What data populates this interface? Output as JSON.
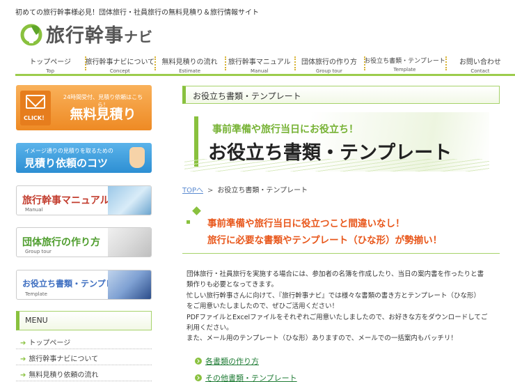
{
  "header": {
    "tagline": "初めての旅行幹事様必見！団体旅行・社員旅行の無料見積り＆旅行情報サイト",
    "logo_main": "旅行幹事",
    "logo_suffix": "ナビ"
  },
  "nav": [
    {
      "jp": "トップページ",
      "en": "Top"
    },
    {
      "jp": "旅行幹事ナビについて",
      "en": "Concept"
    },
    {
      "jp": "無料見積りの流れ",
      "en": "Estimate"
    },
    {
      "jp": "旅行幹事マニュアル",
      "en": "Manual"
    },
    {
      "jp": "団体旅行の作り方",
      "en": "Group tour"
    },
    {
      "jp": "お役立ち書類・テンプレート",
      "en": "Template"
    },
    {
      "jp": "お問い合わせ",
      "en": "Contact"
    }
  ],
  "sidebar": {
    "estimate_banner": {
      "click": "CLICK！",
      "small": "24時間受付、見積り依頼はこちら！",
      "big": "無料見積り"
    },
    "tips_banner": {
      "small": "イメージ通りの見積りを取るための",
      "big": "見積り依頼のコツ"
    },
    "manual_banner": {
      "title": "旅行幹事マニュアル",
      "sub": "Manual"
    },
    "group_banner": {
      "title": "団体旅行の作り方",
      "sub": "Group tour"
    },
    "docs_banner": {
      "title": "お役立ち書類・テンプレート",
      "sub": "Template"
    },
    "menu_heading": "MENU",
    "menu_items": [
      "トップページ",
      "旅行幹事ナビについて",
      "無料見積り依頼の流れ"
    ]
  },
  "main": {
    "section_title": "お役立ち書類・テンプレート",
    "hero_sub": "事前準備や旅行当日にお役立ち！",
    "hero_main": "お役立ち書類・テンプレート",
    "breadcrumb": {
      "top": "TOPへ",
      "sep": ">",
      "current": "お役立ち書類・テンプレート"
    },
    "lead_line1": "事前準備や旅行当日に役立つこと間違いなし！",
    "lead_line2": "旅行に必要な書類やテンプレート（ひな形）が勢揃い！",
    "body_lines": [
      "団体旅行・社員旅行を実施する場合には、参加者の名簿を作成したり、当日の案内書を作ったりと書",
      "類作りも必要となってきます。",
      "忙しい旅行幹事さんに向けて、『旅行幹事ナビ』では様々な書類の書き方とテンプレート（ひな形）",
      "をご用意いたしましたので、ぜひご活用ください！",
      "PDFファイルとExcelファイルをそれぞれご用意いたしましたので、お好きな方をダウンロードしてご",
      "利用ください。",
      "また、メール用のテンプレート（ひな形）ありますので、メールでの一括案内もバッチリ！"
    ],
    "links": [
      "各書類の作り方",
      "その他書類・テンプレート"
    ]
  },
  "colors": {
    "accent_green": "#89c13e",
    "orange": "#e8571b",
    "nav_divider": "#d7b230"
  }
}
